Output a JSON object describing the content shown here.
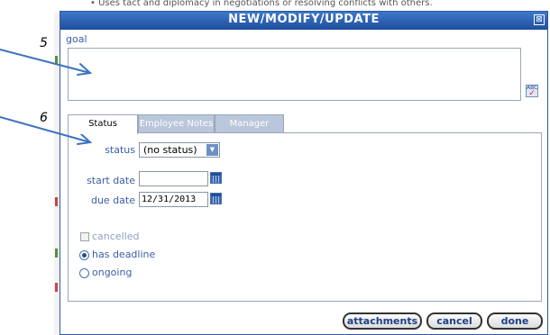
{
  "background": {
    "text": "• Uses tact and diplomacy in negotiations or resolving conflicts with others."
  },
  "dialog": {
    "title": "NEW/MODIFY/UPDATE",
    "close_glyph": "⊠"
  },
  "goal": {
    "label": "goal",
    "value": ""
  },
  "tabs": [
    {
      "label": "Status",
      "active": true
    },
    {
      "label": "Employee Notes",
      "active": false
    },
    {
      "label": "Manager Notes",
      "active": false
    }
  ],
  "status_tab": {
    "status_label": "status",
    "status_value": "(no status)",
    "start_date_label": "start date",
    "start_date_value": "",
    "due_date_label": "due date",
    "due_date_value": "12/31/2013",
    "cancelled_label": "cancelled",
    "has_deadline_label": "has deadline",
    "ongoing_label": "ongoing",
    "selected_option": "has deadline"
  },
  "buttons": {
    "attachments": "attachments",
    "cancel": "cancel",
    "done": "done"
  },
  "annotations": [
    {
      "number": "5"
    },
    {
      "number": "6"
    }
  ],
  "icons": {
    "spellcheck": "spellcheck-icon",
    "calendar": "calendar-icon"
  },
  "colors": {
    "title_bar": "#1d4f9c",
    "label_text": "#3b5ea8",
    "arrow": "#3d72c0"
  }
}
